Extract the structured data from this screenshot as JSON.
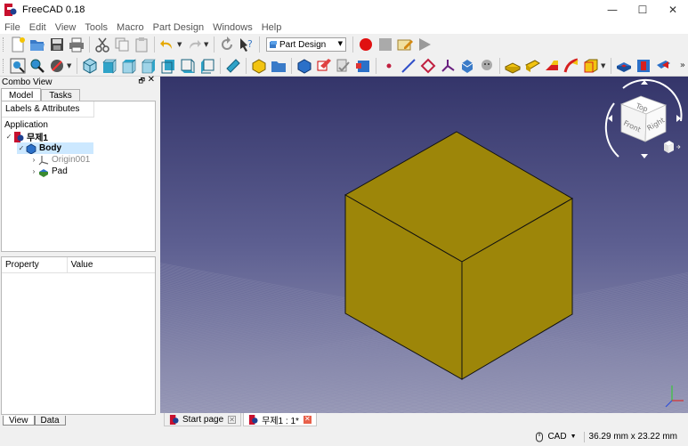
{
  "window": {
    "title": "FreeCAD 0.18",
    "minimize": "—",
    "maximize": "☐",
    "close": "✕"
  },
  "menu": [
    "File",
    "Edit",
    "View",
    "Tools",
    "Macro",
    "Part Design",
    "Windows",
    "Help"
  ],
  "workbench_selector": {
    "value": "Part Design"
  },
  "combo_view": {
    "title": "Combo View",
    "tabs": [
      "Model",
      "Tasks"
    ],
    "tree_header": "Labels & Attributes",
    "tree": {
      "root": "Application",
      "document": "무제1",
      "body": "Body",
      "origin": "Origin001",
      "pad": "Pad"
    },
    "property_columns": [
      "Property",
      "Value"
    ],
    "bottom_tabs": [
      "View",
      "Data"
    ]
  },
  "view3d": {
    "background_top": "#34356a",
    "background_bottom": "#9596b4",
    "solid_color": "#9d8609",
    "navcube": {
      "top": "Top",
      "front": "Front",
      "right": "Right"
    }
  },
  "doc_tabs": [
    {
      "label": "Start page"
    },
    {
      "label": "무제1 : 1*"
    }
  ],
  "status": {
    "navigation_style": "CAD",
    "dimensions": "36.29 mm x 23.22 mm"
  }
}
